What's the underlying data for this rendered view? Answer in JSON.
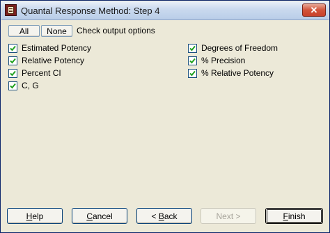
{
  "window": {
    "title": "Quantal Response Method: Step 4"
  },
  "icons": {
    "app": "app-icon",
    "close": "close-icon",
    "check": "check-icon"
  },
  "toolbar": {
    "all_label": "All",
    "none_label": "None",
    "hint": "Check output options"
  },
  "options": {
    "left": [
      {
        "label": "Estimated Potency",
        "checked": true
      },
      {
        "label": "Relative Potency",
        "checked": true
      },
      {
        "label": "Percent CI",
        "checked": true
      },
      {
        "label": "C, G",
        "checked": true
      }
    ],
    "right": [
      {
        "label": "Degrees of Freedom",
        "checked": true
      },
      {
        "label": "% Precision",
        "checked": true
      },
      {
        "label": "% Relative Potency",
        "checked": true
      }
    ]
  },
  "buttons": {
    "help": "Help",
    "cancel": "Cancel",
    "back_prefix": "< ",
    "back_accel": "B",
    "back_rest": "ack",
    "next": "Next >",
    "finish_accel": "F",
    "finish_rest": "inish",
    "help_accel": "H",
    "help_rest": "elp",
    "cancel_accel": "C",
    "cancel_rest": "ancel"
  },
  "colors": {
    "titlebar": "#c9d9ee",
    "close": "#d2533a",
    "face": "#ece9d8"
  }
}
